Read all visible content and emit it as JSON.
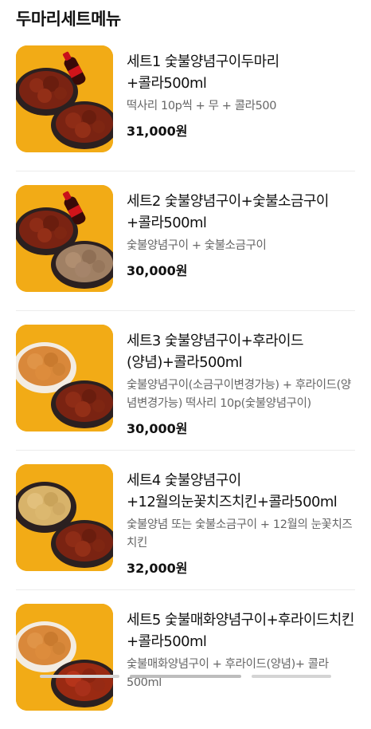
{
  "section": {
    "title": "두마리세트메뉴"
  },
  "items": [
    {
      "name": "세트1 숯불양념구이두마리+콜라500ml",
      "desc": "떡사리 10p씩 + 무 + 콜라500",
      "price": "31,000원",
      "image": "two-sauce-chicken-plates-with-cola"
    },
    {
      "name": "세트2 숯불양념구이+숯불소금구이+콜라500ml",
      "desc": "숯불양념구이 + 숯불소금구이",
      "price": "30,000원",
      "image": "sauce-and-salt-chicken-plates-with-cola"
    },
    {
      "name": "세트3 숯불양념구이+후라이드(양념)+콜라500ml",
      "desc": "숯불양념구이(소금구이변경가능) + 후라이드(양념변경가능) 떡사리 10p(숯불양념구이)",
      "price": "30,000원",
      "image": "fried-and-sauce-chicken-plates"
    },
    {
      "name": "세트4 숯불양념구이+12월의눈꽃치즈치킨+콜라500ml",
      "desc": "숯불양념 또는 숯불소금구이 + 12월의 눈꽃치즈치킨",
      "price": "32,000원",
      "image": "cheese-and-sauce-chicken-plates"
    },
    {
      "name": "세트5 숯불매화양념구이+후라이드치킨+콜라500ml",
      "desc": "숯불매화양념구이 + 후라이드(양념)+ 콜라500ml",
      "price": "",
      "image": "fried-and-spicy-chicken-plates"
    }
  ],
  "colors": {
    "thumb_bg": "#f2ab16",
    "sauce_chicken": "#7a2312",
    "salt_chicken": "#a08064",
    "fried_chicken": "#d9883a",
    "cheese_chicken": "#d8b36a",
    "plate": "#2b2020"
  }
}
